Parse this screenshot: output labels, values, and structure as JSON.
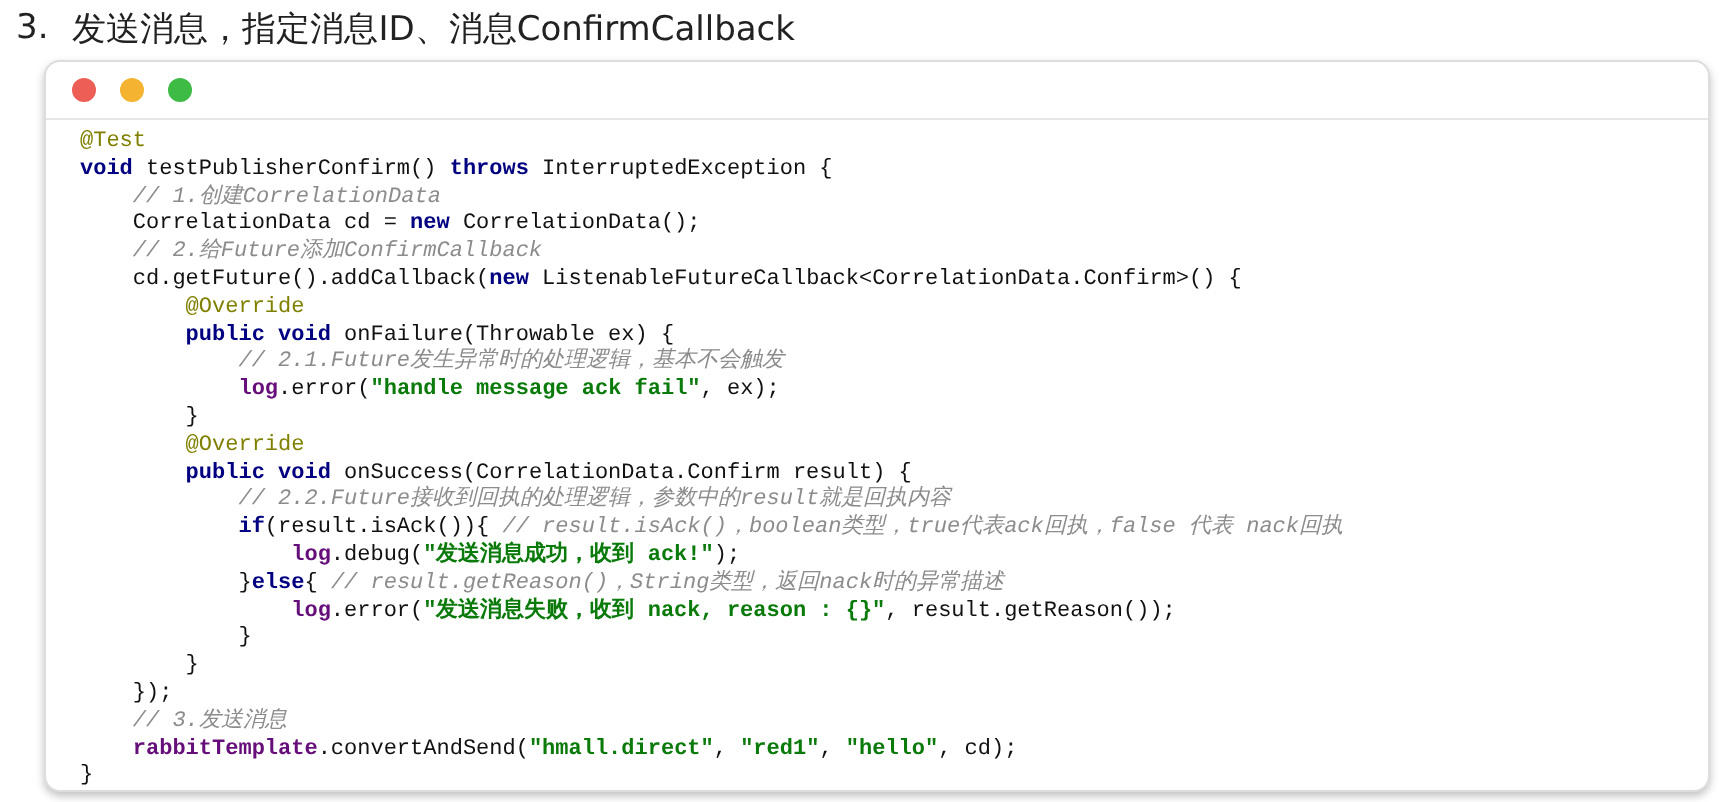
{
  "heading": {
    "number": "3.",
    "text": "发送消息，指定消息ID、消息ConfirmCallback"
  },
  "code_window": {
    "lines": [
      [
        {
          "kind": "annotation",
          "text": "@Test"
        }
      ],
      [
        {
          "kind": "keyword",
          "text": "void"
        },
        {
          "kind": "plain",
          "text": " testPublisherConfirm() "
        },
        {
          "kind": "keyword",
          "text": "throws"
        },
        {
          "kind": "plain",
          "text": " InterruptedException {"
        }
      ],
      [
        {
          "kind": "comment",
          "text": "    // 1.创建CorrelationData"
        }
      ],
      [
        {
          "kind": "plain",
          "text": "    CorrelationData cd = "
        },
        {
          "kind": "keyword",
          "text": "new"
        },
        {
          "kind": "plain",
          "text": " CorrelationData();"
        }
      ],
      [
        {
          "kind": "comment",
          "text": "    // 2.给Future添加ConfirmCallback"
        }
      ],
      [
        {
          "kind": "plain",
          "text": "    cd.getFuture().addCallback("
        },
        {
          "kind": "keyword",
          "text": "new"
        },
        {
          "kind": "plain",
          "text": " ListenableFutureCallback<CorrelationData.Confirm>() {"
        }
      ],
      [
        {
          "kind": "annotation",
          "text": "        @Override"
        }
      ],
      [
        {
          "kind": "keyword",
          "text": "        public void"
        },
        {
          "kind": "plain",
          "text": " onFailure(Throwable ex) {"
        }
      ],
      [
        {
          "kind": "comment",
          "text": "            // 2.1.Future发生异常时的处理逻辑，基本不会触发"
        }
      ],
      [
        {
          "kind": "field",
          "text": "            log"
        },
        {
          "kind": "plain",
          "text": ".error("
        },
        {
          "kind": "string",
          "text": "\"handle message ack fail\""
        },
        {
          "kind": "plain",
          "text": ", ex);"
        }
      ],
      [
        {
          "kind": "plain",
          "text": "        }"
        }
      ],
      [
        {
          "kind": "annotation",
          "text": "        @Override"
        }
      ],
      [
        {
          "kind": "keyword",
          "text": "        public void"
        },
        {
          "kind": "plain",
          "text": " onSuccess(CorrelationData.Confirm result) {"
        }
      ],
      [
        {
          "kind": "comment",
          "text": "            // 2.2.Future接收到回执的处理逻辑，参数中的result就是回执内容"
        }
      ],
      [
        {
          "kind": "keyword",
          "text": "            if"
        },
        {
          "kind": "plain",
          "text": "(result.isAck()){ "
        },
        {
          "kind": "comment",
          "text": "// result.isAck()，boolean类型，true代表ack回执，false 代表 nack回执"
        }
      ],
      [
        {
          "kind": "field",
          "text": "                log"
        },
        {
          "kind": "plain",
          "text": ".debug("
        },
        {
          "kind": "string",
          "text": "\"发送消息成功，收到 ack!\""
        },
        {
          "kind": "plain",
          "text": ");"
        }
      ],
      [
        {
          "kind": "plain",
          "text": "            }"
        },
        {
          "kind": "keyword",
          "text": "else"
        },
        {
          "kind": "plain",
          "text": "{ "
        },
        {
          "kind": "comment",
          "text": "// result.getReason()，String类型，返回nack时的异常描述"
        }
      ],
      [
        {
          "kind": "field",
          "text": "                log"
        },
        {
          "kind": "plain",
          "text": ".error("
        },
        {
          "kind": "string",
          "text": "\"发送消息失败，收到 nack, reason : {}\""
        },
        {
          "kind": "plain",
          "text": ", result.getReason());"
        }
      ],
      [
        {
          "kind": "plain",
          "text": "            }"
        }
      ],
      [
        {
          "kind": "plain",
          "text": "        }"
        }
      ],
      [
        {
          "kind": "plain",
          "text": "    });"
        }
      ],
      [
        {
          "kind": "comment",
          "text": "    // 3.发送消息"
        }
      ],
      [
        {
          "kind": "field",
          "text": "    rabbitTemplate"
        },
        {
          "kind": "plain",
          "text": ".convertAndSend("
        },
        {
          "kind": "string",
          "text": "\"hmall.direct\""
        },
        {
          "kind": "plain",
          "text": ", "
        },
        {
          "kind": "string",
          "text": "\"red1\""
        },
        {
          "kind": "plain",
          "text": ", "
        },
        {
          "kind": "string",
          "text": "\"hello\""
        },
        {
          "kind": "plain",
          "text": ", cd);"
        }
      ],
      [
        {
          "kind": "plain",
          "text": "}"
        }
      ]
    ]
  }
}
